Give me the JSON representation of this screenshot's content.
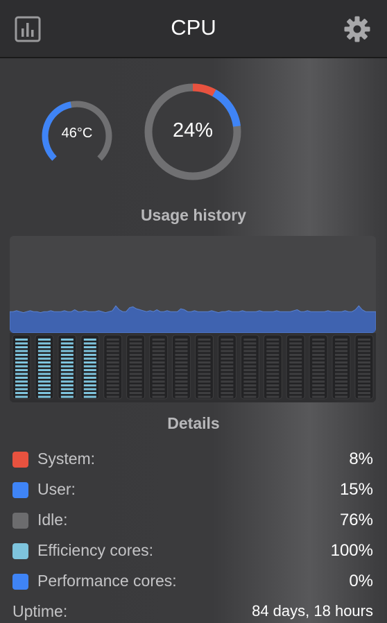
{
  "header": {
    "title": "CPU",
    "left_icon": "bar-chart-icon",
    "right_icon": "gear-icon"
  },
  "temperature": {
    "label": "46°C",
    "value": 46
  },
  "usage": {
    "label": "24%",
    "system_pct": 8,
    "user_pct": 15,
    "idle_pct": 76
  },
  "history": {
    "title": "Usage history",
    "samples": [
      22,
      22,
      23,
      22,
      21,
      22,
      23,
      22,
      22,
      21,
      22,
      22,
      23,
      22,
      22,
      22,
      23,
      22,
      22,
      24,
      22,
      22,
      23,
      22,
      22,
      22,
      23,
      22,
      21,
      22,
      23,
      28,
      24,
      22,
      22,
      26,
      27,
      25,
      24,
      23,
      22,
      23,
      22,
      24,
      22,
      22,
      23,
      22,
      22,
      22,
      25,
      24,
      22,
      22,
      23,
      22,
      22,
      22,
      22,
      23,
      22,
      21,
      22,
      22,
      23,
      22,
      22,
      22,
      23,
      22,
      22,
      22,
      22,
      23,
      22,
      22,
      22,
      22,
      23,
      22,
      22,
      22,
      22,
      23,
      24,
      22,
      22,
      23,
      22,
      22,
      22,
      22,
      22,
      23,
      22,
      22,
      22,
      22,
      23,
      22,
      22,
      24,
      28,
      24,
      22,
      22,
      22,
      22
    ]
  },
  "cores": {
    "efficiency_count": 4,
    "performance_count": 12,
    "efficiency_load_pct": 100,
    "performance_load_pct": 0
  },
  "details": {
    "title": "Details",
    "rows": [
      {
        "label": "System:",
        "value": "8%",
        "color": "#e8523f"
      },
      {
        "label": "User:",
        "value": "15%",
        "color": "#3f84f6"
      },
      {
        "label": "Idle:",
        "value": "76%",
        "color": "#6c6c6e"
      },
      {
        "label": "Efficiency cores:",
        "value": "100%",
        "color": "#7ec4dd"
      },
      {
        "label": "Performance cores:",
        "value": "0%",
        "color": "#3f84f6"
      }
    ],
    "uptime": {
      "label": "Uptime:",
      "value": "84 days, 18 hours"
    }
  },
  "colors": {
    "system": "#e8523f",
    "user": "#3f84f6",
    "idle": "#6c6c6e",
    "efficiency": "#7ec4dd",
    "history_fill": "#3f63b0"
  }
}
